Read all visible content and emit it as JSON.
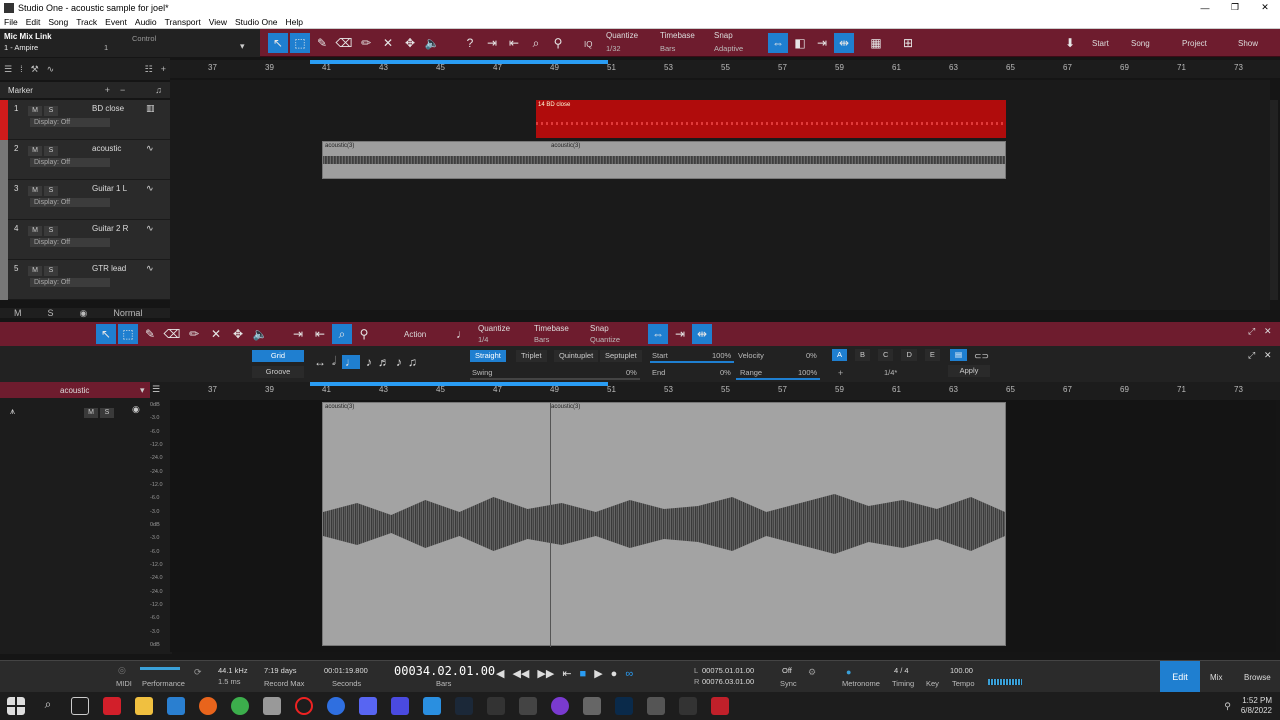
{
  "window": {
    "title": "Studio One - acoustic sample for joel*"
  },
  "menu": [
    "File",
    "Edit",
    "Song",
    "Track",
    "Event",
    "Audio",
    "Transport",
    "View",
    "Studio One",
    "Help"
  ],
  "toolbar": {
    "device": "Mic Mix Link",
    "device_sub": "1 - Ampire",
    "control": "Control",
    "channel": "1",
    "quantize_label": "Quantize",
    "quantize_value": "1/32",
    "timebase_label": "Timebase",
    "timebase_value": "Bars",
    "snap_label": "Snap",
    "snap_value": "Adaptive",
    "iq": "IQ",
    "start": "Start",
    "song": "Song",
    "project": "Project",
    "show": "Show"
  },
  "ruler": {
    "marks": [
      "37",
      "39",
      "41",
      "43",
      "45",
      "47",
      "49",
      "51",
      "53",
      "55",
      "57",
      "59",
      "61",
      "63",
      "65",
      "67",
      "69",
      "71",
      "73"
    ]
  },
  "marker_lane": {
    "label": "Marker"
  },
  "tracks": [
    {
      "num": "1",
      "name": "BD close",
      "display": "Display: Off",
      "color": "#d01b1b"
    },
    {
      "num": "2",
      "name": "acoustic",
      "display": "Display: Off",
      "color": "#777"
    },
    {
      "num": "3",
      "name": "Guitar 1 L",
      "display": "Display: Off",
      "color": "#777"
    },
    {
      "num": "4",
      "name": "Guitar 2 R",
      "display": "Display: Off",
      "color": "#777"
    },
    {
      "num": "5",
      "name": "GTR lead",
      "display": "Display: Off",
      "color": "#777"
    }
  ],
  "arrange_footer": {
    "m": "M",
    "s": "S",
    "mode": "Normal"
  },
  "clips": {
    "bd": "14 BD close",
    "ac1": "acoustic(3)",
    "ac2": "acoustic(3)"
  },
  "editor": {
    "action": "Action",
    "quantize_label": "Quantize",
    "quantize_value": "1/4",
    "timebase_label": "Timebase",
    "timebase_value": "Bars",
    "snap_label": "Snap",
    "snap_value": "Quantize",
    "grid": "Grid",
    "groove": "Groove",
    "straight": "Straight",
    "triplet": "Triplet",
    "quintuplet": "Quintuplet",
    "septuplet": "Septuplet",
    "swing": "Swing",
    "swing_val": "0%",
    "start": "Start",
    "start_val": "100%",
    "end": "End",
    "end_val": "0%",
    "velocity": "Velocity",
    "velocity_val": "0%",
    "range": "Range",
    "range_val": "100%",
    "letters": [
      "A",
      "B",
      "C",
      "D",
      "E"
    ],
    "quant_sel": "1/4*",
    "apply": "Apply",
    "track": "acoustic",
    "m": "M",
    "s": "S",
    "db_scale": [
      "0dB",
      "-3.0",
      "-6.0",
      "-12.0",
      "-24.0",
      "-24.0",
      "-12.0",
      "-6.0",
      "-3.0",
      "0dB",
      "-3.0",
      "-6.0",
      "-12.0",
      "-24.0",
      "-24.0",
      "-12.0",
      "-6.0",
      "-3.0",
      "0dB"
    ]
  },
  "transport": {
    "midi": "MIDI",
    "performance": "Performance",
    "samplerate": "44.1 kHz",
    "latency": "1.5 ms",
    "record_days": "7:19 days",
    "record_max": "Record Max",
    "seconds_val": "00:01:19.800",
    "seconds": "Seconds",
    "bars_val": "00034.02.01.00",
    "bars": "Bars",
    "loop_l": "00075.01.01.00",
    "loop_r": "00076.03.01.00",
    "off": "Off",
    "sync": "Sync",
    "metronome": "Metronome",
    "sig": "4 / 4",
    "timing": "Timing",
    "key": "Key",
    "tempo_val": "100.00",
    "tempo": "Tempo",
    "edit": "Edit",
    "mix": "Mix",
    "browse": "Browse",
    "l": "L",
    "r": "R"
  },
  "taskbar": {
    "time": "1:52 PM",
    "date": "6/8/2022"
  }
}
